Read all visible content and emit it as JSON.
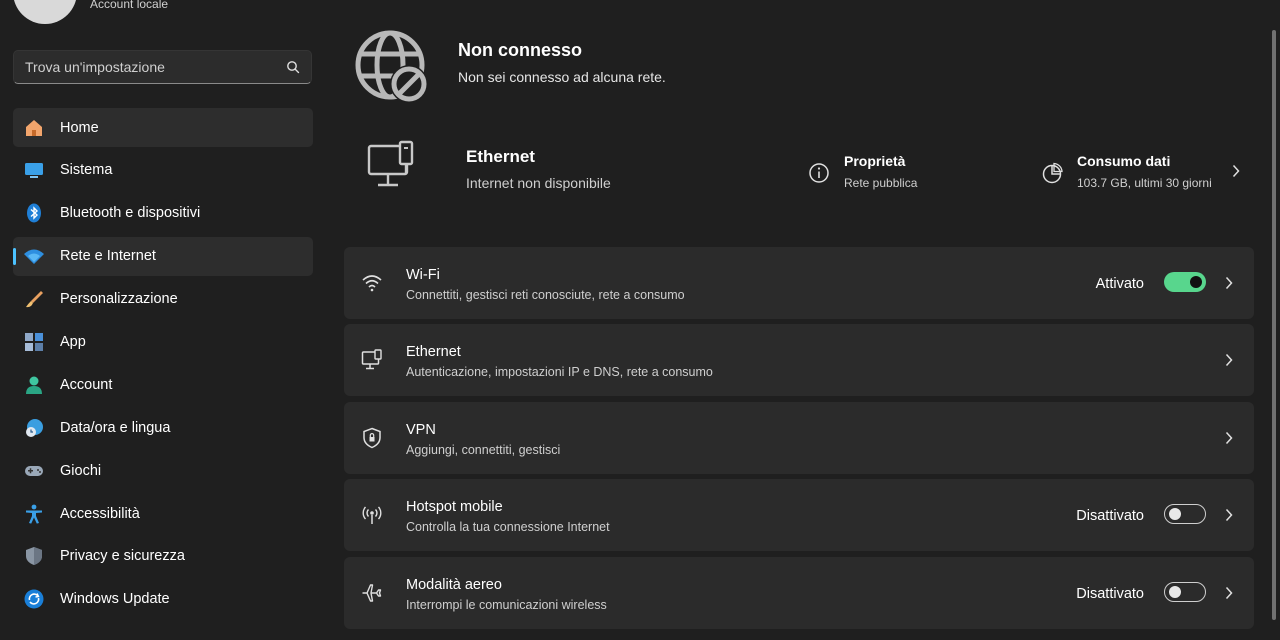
{
  "sidebar": {
    "account_label": "Account locale",
    "search": {
      "placeholder": "Trova un'impostazione"
    },
    "items": [
      {
        "label": "Home",
        "icon": "home-icon"
      },
      {
        "label": "Sistema",
        "icon": "system-icon"
      },
      {
        "label": "Bluetooth e dispositivi",
        "icon": "bluetooth-icon"
      },
      {
        "label": "Rete e Internet",
        "icon": "wifi-icon"
      },
      {
        "label": "Personalizzazione",
        "icon": "brush-icon"
      },
      {
        "label": "App",
        "icon": "apps-icon"
      },
      {
        "label": "Account",
        "icon": "person-icon"
      },
      {
        "label": "Data/ora e lingua",
        "icon": "clock-globe-icon"
      },
      {
        "label": "Giochi",
        "icon": "gamepad-icon"
      },
      {
        "label": "Accessibilità",
        "icon": "accessibility-icon"
      },
      {
        "label": "Privacy e sicurezza",
        "icon": "shield-icon"
      },
      {
        "label": "Windows Update",
        "icon": "update-icon"
      }
    ]
  },
  "status": {
    "title": "Non connesso",
    "subtitle": "Non sei connesso ad alcuna rete."
  },
  "ethernet_summary": {
    "title": "Ethernet",
    "subtitle": "Internet non disponibile",
    "properties": {
      "title": "Proprietà",
      "subtitle": "Rete pubblica"
    },
    "data_usage": {
      "title": "Consumo dati",
      "subtitle": "103.7 GB, ultimi 30 giorni"
    }
  },
  "cards": [
    {
      "title": "Wi-Fi",
      "subtitle": "Connettiti, gestisci reti conosciute, rete a consumo",
      "state": "Attivato",
      "toggle": "on",
      "icon": "wifi-icon"
    },
    {
      "title": "Ethernet",
      "subtitle": "Autenticazione, impostazioni IP e DNS, rete a consumo",
      "state": "",
      "icon": "ethernet-icon"
    },
    {
      "title": "VPN",
      "subtitle": "Aggiungi, connettiti, gestisci",
      "state": "",
      "icon": "vpn-shield-icon"
    },
    {
      "title": "Hotspot mobile",
      "subtitle": "Controlla la tua connessione Internet",
      "state": "Disattivato",
      "toggle": "off",
      "icon": "hotspot-icon"
    },
    {
      "title": "Modalità aereo",
      "subtitle": "Interrompi le comunicazioni wireless",
      "state": "Disattivato",
      "toggle": "off",
      "icon": "airplane-icon"
    }
  ],
  "colors": {
    "accent": "#4cc2ff",
    "toggle_on": "#58d68d",
    "background": "#1f1f1f",
    "card": "#2b2b2b"
  }
}
